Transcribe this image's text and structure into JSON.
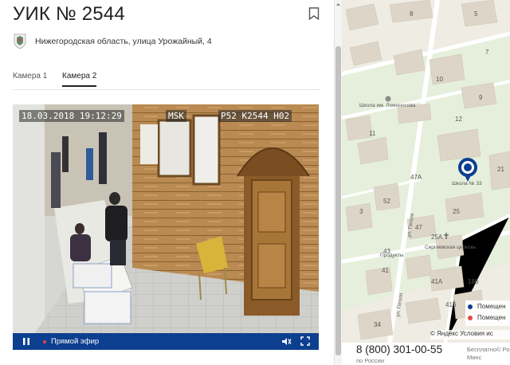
{
  "page": {
    "title": "УИК № 2544",
    "address": "Нижегородская область, улица Урожайный, 4"
  },
  "tabs": [
    {
      "label": "Камера 1",
      "active": false
    },
    {
      "label": "Камера 2",
      "active": true
    }
  ],
  "video": {
    "osd_datetime": "18.03.2018 19:12:29",
    "osd_timezone": "MSK",
    "osd_camera_code": "P52 K2544 H02",
    "live_label": "Прямой эфир"
  },
  "map": {
    "building_numbers": [
      "5",
      "8",
      "7",
      "10",
      "9",
      "12",
      "11",
      "21",
      "47А",
      "52",
      "25",
      "3",
      "47",
      "25А",
      "41",
      "43",
      "41А",
      "18б",
      "34",
      "41б"
    ],
    "poi_labels": [
      "Школа им. Ломоносова",
      "Школа № 33",
      "Сергиевская церковь",
      "Продукты"
    ],
    "street_labels": [
      "ул. Гоголя"
    ],
    "legend": [
      {
        "label": "Помещен",
        "color": "#0d3f8f"
      },
      {
        "label": "Помещен",
        "color": "#e64545"
      }
    ],
    "copyright": "© Яндекс Условия ис"
  },
  "footer": {
    "phone": "8 (800) 301-00-55",
    "phone_note": "по России",
    "free_call_line1": "Бесплатно© Рос",
    "free_call_line2": "Минс"
  },
  "colors": {
    "player_bar": "#0d3f8f",
    "live_dot": "#e64545",
    "map_background": "#efece4"
  },
  "icons": [
    "bookmark-icon",
    "emblem-icon",
    "pause-icon",
    "volume-icon",
    "fullscreen-icon",
    "map-pin-icon",
    "church-icon"
  ]
}
